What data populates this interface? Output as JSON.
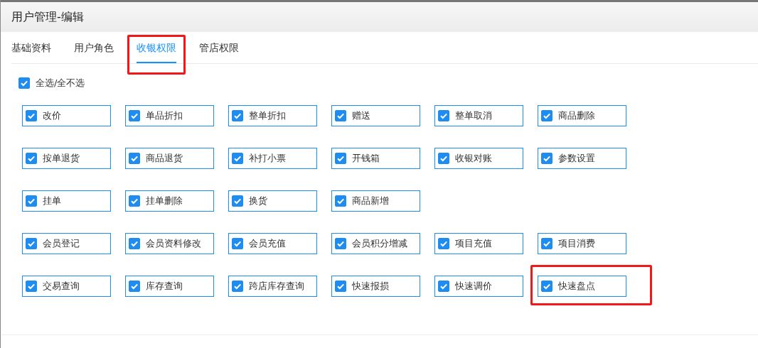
{
  "window": {
    "title": "用户管理-编辑"
  },
  "tabs": [
    {
      "label": "基础资料",
      "selected": false,
      "highlighted": false
    },
    {
      "label": "用户角色",
      "selected": false,
      "highlighted": false
    },
    {
      "label": "收银权限",
      "selected": true,
      "highlighted": true
    },
    {
      "label": "管店权限",
      "selected": false,
      "highlighted": false
    }
  ],
  "select_all": {
    "label": "全选/全不选",
    "checked": true
  },
  "permission_rows": [
    [
      {
        "label": "改价",
        "checked": true,
        "highlighted": false
      },
      {
        "label": "单品折扣",
        "checked": true,
        "highlighted": false
      },
      {
        "label": "整单折扣",
        "checked": true,
        "highlighted": false
      },
      {
        "label": "赠送",
        "checked": true,
        "highlighted": false
      },
      {
        "label": "整单取消",
        "checked": true,
        "highlighted": false
      },
      {
        "label": "商品删除",
        "checked": true,
        "highlighted": false
      }
    ],
    [
      {
        "label": "按单退货",
        "checked": true,
        "highlighted": false
      },
      {
        "label": "商品退货",
        "checked": true,
        "highlighted": false
      },
      {
        "label": "补打小票",
        "checked": true,
        "highlighted": false
      },
      {
        "label": "开钱箱",
        "checked": true,
        "highlighted": false
      },
      {
        "label": "收银对账",
        "checked": true,
        "highlighted": false
      },
      {
        "label": "参数设置",
        "checked": true,
        "highlighted": false
      }
    ],
    [
      {
        "label": "挂单",
        "checked": true,
        "highlighted": false
      },
      {
        "label": "挂单删除",
        "checked": true,
        "highlighted": false
      },
      {
        "label": "换货",
        "checked": true,
        "highlighted": false
      },
      {
        "label": "商品新增",
        "checked": true,
        "highlighted": false
      }
    ],
    [
      {
        "label": "会员登记",
        "checked": true,
        "highlighted": false
      },
      {
        "label": "会员资料修改",
        "checked": true,
        "highlighted": false
      },
      {
        "label": "会员充值",
        "checked": true,
        "highlighted": false
      },
      {
        "label": "会员积分增减",
        "checked": true,
        "highlighted": false
      },
      {
        "label": "项目充值",
        "checked": true,
        "highlighted": false
      },
      {
        "label": "项目消费",
        "checked": true,
        "highlighted": false
      }
    ],
    [
      {
        "label": "交易查询",
        "checked": true,
        "highlighted": false
      },
      {
        "label": "库存查询",
        "checked": true,
        "highlighted": false
      },
      {
        "label": "跨店库存查询",
        "checked": true,
        "highlighted": false
      },
      {
        "label": "快速报损",
        "checked": true,
        "highlighted": false
      },
      {
        "label": "快速调价",
        "checked": true,
        "highlighted": false
      },
      {
        "label": "快速盘点",
        "checked": true,
        "highlighted": true
      }
    ]
  ]
}
